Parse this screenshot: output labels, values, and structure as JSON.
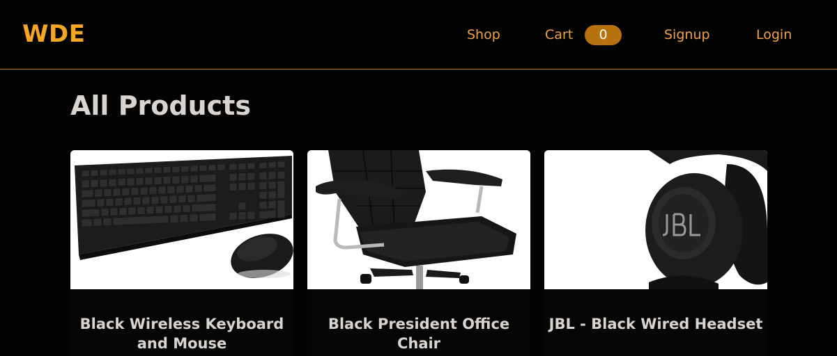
{
  "header": {
    "logo": "WDE",
    "nav": {
      "shop": "Shop",
      "cart": "Cart",
      "cart_count": "0",
      "signup": "Signup",
      "login": "Login"
    }
  },
  "main": {
    "title": "All Products",
    "products": [
      {
        "name": "Black Wireless Keyboard and Mouse",
        "image": "keyboard-mouse-image"
      },
      {
        "name": "Black President Office Chair",
        "image": "office-chair-image"
      },
      {
        "name": "JBL - Black Wired Headset",
        "image": "headset-image"
      }
    ]
  }
}
